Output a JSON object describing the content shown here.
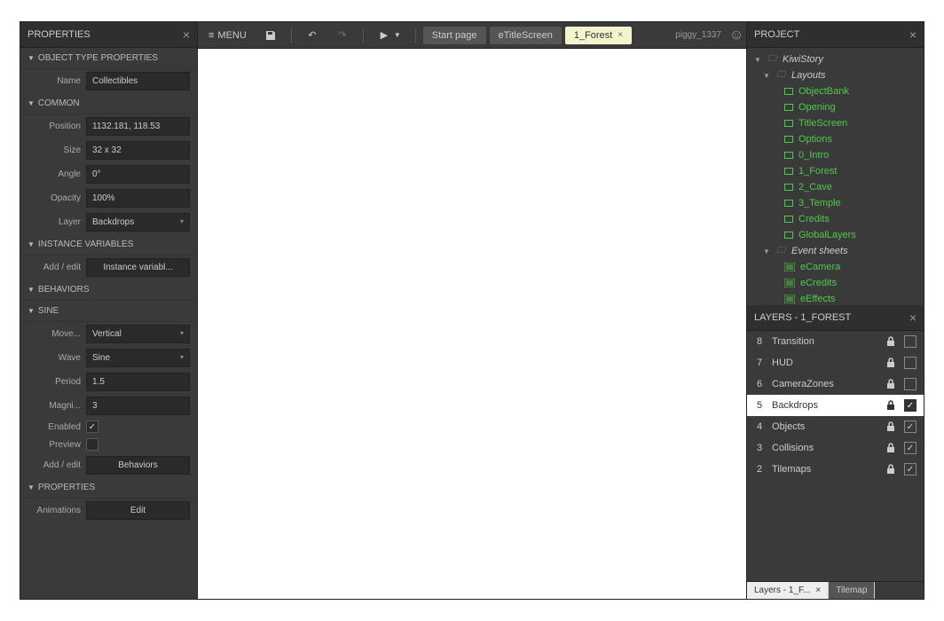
{
  "properties_panel": {
    "title": "PROPERTIES",
    "sections": {
      "object_type": {
        "title": "OBJECT TYPE PROPERTIES",
        "name_label": "Name",
        "name_value": "Collectibles"
      },
      "common": {
        "title": "COMMON",
        "position_label": "Position",
        "position_value": "1132.181, 118.53",
        "size_label": "Size",
        "size_value": "32 x 32",
        "angle_label": "Angle",
        "angle_value": "0°",
        "opacity_label": "Opacity",
        "opacity_value": "100%",
        "layer_label": "Layer",
        "layer_value": "Backdrops"
      },
      "instance_vars": {
        "title": "INSTANCE VARIABLES",
        "addedit_label": "Add / edit",
        "button": "Instance variabl..."
      },
      "behaviors": {
        "title": "BEHAVIORS"
      },
      "sine": {
        "title": "SINE",
        "move_label": "Move...",
        "move_value": "Vertical",
        "wave_label": "Wave",
        "wave_value": "Sine",
        "period_label": "Period",
        "period_value": "1.5",
        "magni_label": "Magni...",
        "magni_value": "3",
        "enabled_label": "Enabled",
        "preview_label": "Preview",
        "addedit_label": "Add / edit",
        "button": "Behaviors"
      },
      "props2": {
        "title": "PROPERTIES",
        "anim_label": "Animations",
        "anim_button": "Edit"
      }
    }
  },
  "toolbar": {
    "menu_label": "MENU",
    "tabs": [
      {
        "label": "Start page",
        "active": false,
        "closable": false
      },
      {
        "label": "eTitleScreen",
        "active": false,
        "closable": false
      },
      {
        "label": "1_Forest",
        "active": true,
        "closable": true
      }
    ],
    "user": "piggy_1337"
  },
  "project_panel": {
    "title": "PROJECT",
    "root": "KiwiStory",
    "layouts_folder": "Layouts",
    "layouts": [
      "ObjectBank",
      "Opening",
      "TitleScreen",
      "Options",
      "0_Intro",
      "1_Forest",
      "2_Cave",
      "3_Temple",
      "Credits",
      "GlobalLayers"
    ],
    "eventsheets_folder": "Event sheets",
    "eventsheets": [
      "eCamera",
      "eCredits",
      "eEffects"
    ]
  },
  "layers_panel": {
    "title": "LAYERS - 1_FOREST",
    "layers": [
      {
        "num": "8",
        "name": "Transition",
        "selected": false,
        "locked": true,
        "visible": false
      },
      {
        "num": "7",
        "name": "HUD",
        "selected": false,
        "locked": true,
        "visible": false
      },
      {
        "num": "6",
        "name": "CameraZones",
        "selected": false,
        "locked": true,
        "visible": false
      },
      {
        "num": "5",
        "name": "Backdrops",
        "selected": true,
        "locked": true,
        "visible": true
      },
      {
        "num": "4",
        "name": "Objects",
        "selected": false,
        "locked": true,
        "visible": true
      },
      {
        "num": "3",
        "name": "Collisions",
        "selected": false,
        "locked": true,
        "visible": true
      },
      {
        "num": "2",
        "name": "Tilemaps",
        "selected": false,
        "locked": true,
        "visible": true
      }
    ],
    "bottom_tabs": {
      "active": "Layers - 1_F...",
      "inactive": "Tilemap"
    }
  }
}
